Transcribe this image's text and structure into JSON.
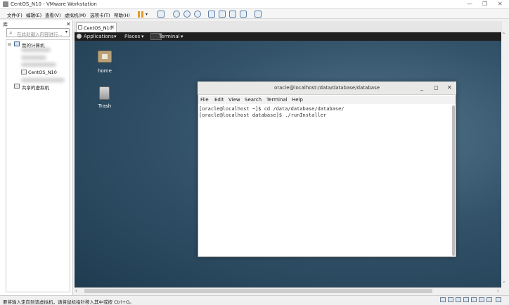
{
  "window": {
    "title": "CentOS_N10 - VMware Workstation",
    "controls": [
      "—",
      "❐",
      "✕"
    ]
  },
  "menubar": {
    "items": [
      "文件(F)",
      "编辑(E)",
      "查看(V)",
      "虚拟机(M)",
      "选项卡(T)",
      "帮助(H)"
    ]
  },
  "sidebar": {
    "header": "库",
    "close": "✕",
    "search_placeholder": "在此处键入内容进行...",
    "tree": {
      "root": "我的计算机",
      "vm": "CentOS_N10",
      "shared": "共享的虚拟机"
    }
  },
  "vmtab": {
    "label": "CentOS_N10",
    "close": "✕"
  },
  "guest": {
    "topbar": {
      "applications": "Applications",
      "places": "Places",
      "terminal": "Terminal"
    },
    "desktop_icons": [
      {
        "label": "home",
        "icon": "folder-home-icon"
      },
      {
        "label": "Trash",
        "icon": "trash-icon"
      }
    ]
  },
  "terminal": {
    "title": "oracle@localhost:/data/database/database",
    "controls": [
      "_",
      "◻",
      "✕"
    ],
    "menu": [
      "File",
      "Edit",
      "View",
      "Search",
      "Terminal",
      "Help"
    ],
    "lines": [
      "[oracle@localhost ~]$ cd /data/database/database/",
      "[oracle@localhost database]$ ./runInstaller"
    ]
  },
  "statusbar": {
    "message": "要将输入定向到该虚拟机，请将鼠标指针移入其中或按 Ctrl+G。"
  },
  "colors": {
    "accent": "#e49a2a",
    "desktop": "#33536a",
    "topbar": "#1f1f1f"
  }
}
